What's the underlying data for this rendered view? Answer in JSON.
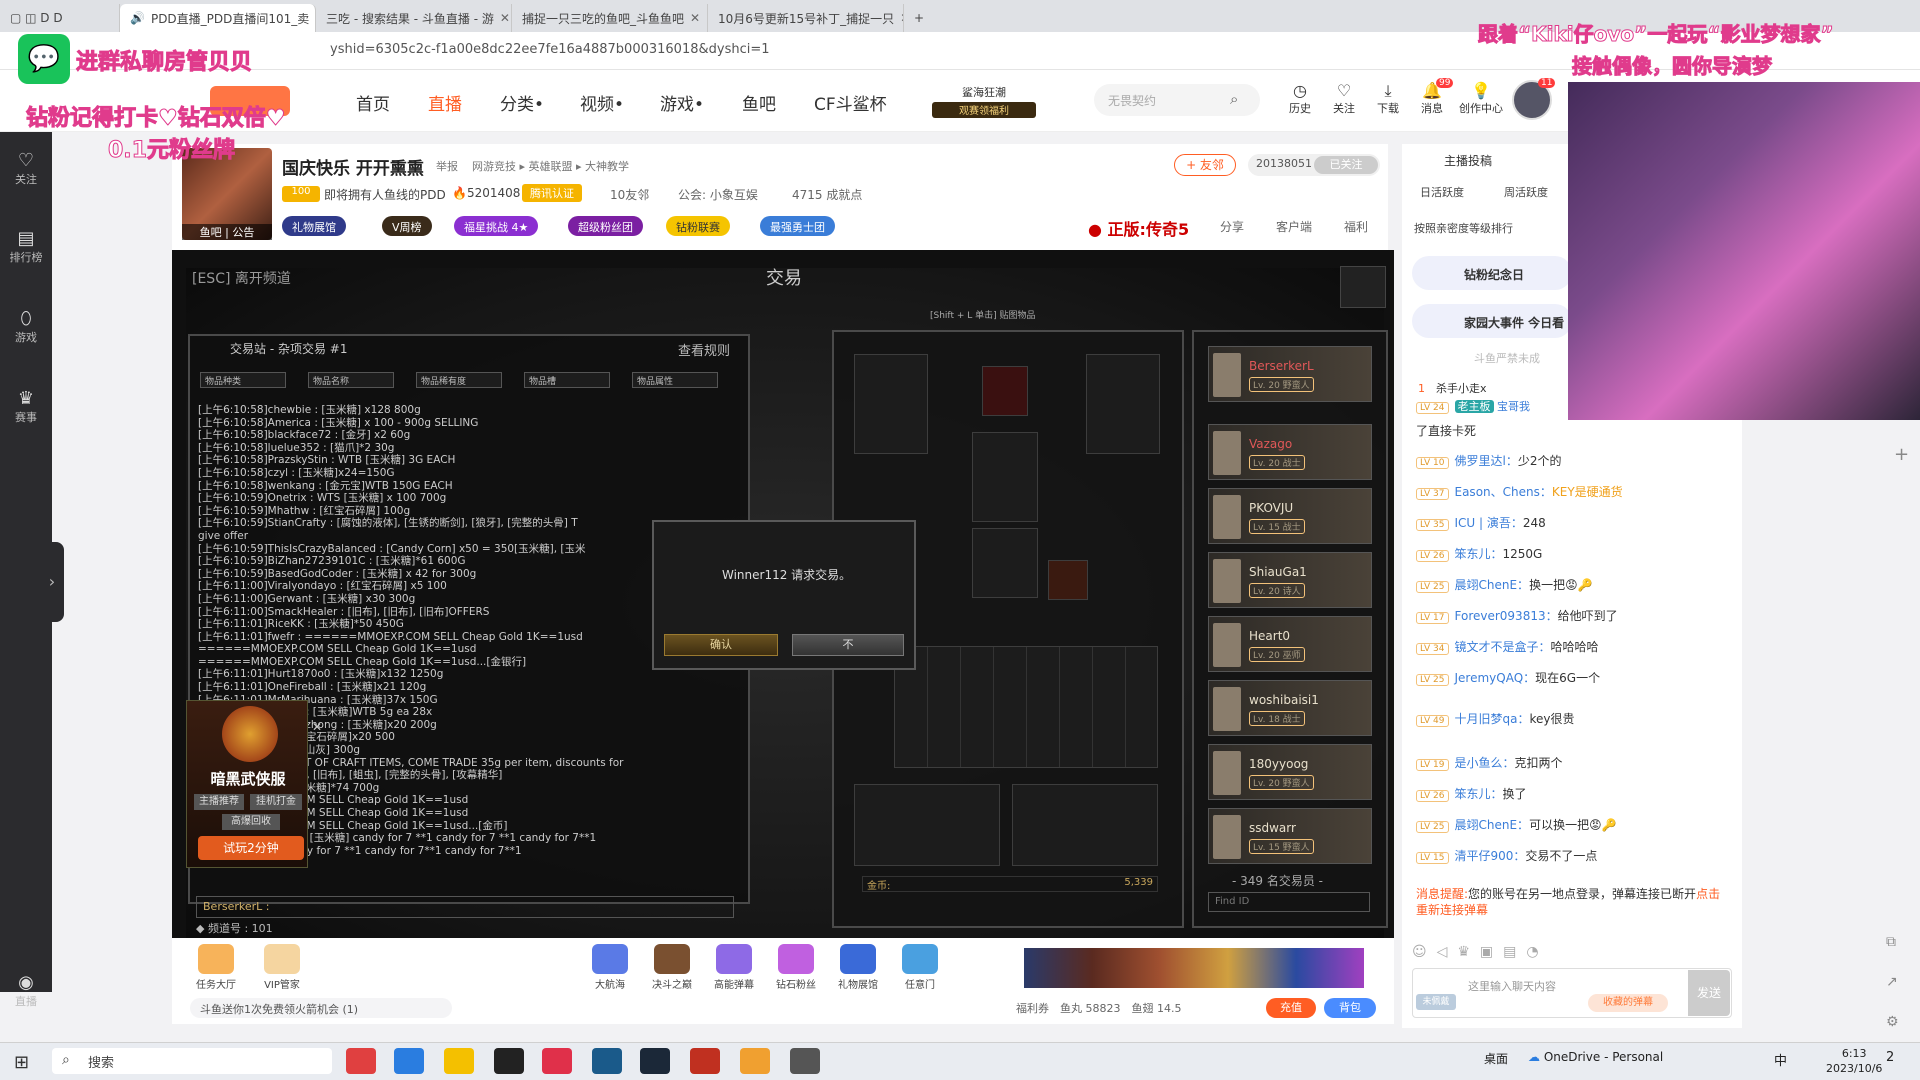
{
  "browser": {
    "tabs": [
      {
        "label": "PDD直播_PDD直播间101_卖"
      },
      {
        "label": "三吃 - 搜索结果 - 斗鱼直播 - 游"
      },
      {
        "label": "捕捉一只三吃的鱼吧_斗鱼鱼吧"
      },
      {
        "label": "10月6号更新15号补丁_捕捉一只"
      }
    ],
    "url": "yshid=6305c2c-f1a00e8dc22ee7fe16a4887b000316018&dyshci=1"
  },
  "overlay": {
    "wechat_text": "进群私聊房管贝贝",
    "promo_line1": "钻粉记得打卡♥钻石双倍♥",
    "promo_line2": "0.1元粉丝牌",
    "top_right_line1": "跟着“Kiki仔ovo”一起玩“影业梦想家”",
    "top_right_line2": "接触偶像，圆你导演梦"
  },
  "header": {
    "nav": [
      "首页",
      "直播",
      "分类•",
      "视频•",
      "游戏•",
      "鱼吧",
      "CF斗鲨杯"
    ],
    "promo": "鲨海狂潮",
    "promo_sub": "观赛领福利",
    "search_placeholder": "无畏契约",
    "icons": [
      {
        "label": "历史",
        "icon": "clock-icon"
      },
      {
        "label": "关注",
        "icon": "heart-icon"
      },
      {
        "label": "下载",
        "icon": "download-icon"
      },
      {
        "label": "消息",
        "icon": "bell-icon",
        "badge": "99"
      },
      {
        "label": "创作中心",
        "icon": "bulb-icon"
      }
    ],
    "avatar_badge": "11"
  },
  "sidebar": [
    {
      "label": "关注",
      "icon": "heart-icon"
    },
    {
      "label": "排行榜",
      "icon": "rank-icon"
    },
    {
      "label": "游戏",
      "icon": "gamepad-icon"
    },
    {
      "label": "赛事",
      "icon": "trophy-icon"
    },
    {
      "label": "直播",
      "icon": "camera-icon"
    }
  ],
  "room": {
    "avatar_tag": "鱼吧 | 公告",
    "title": "国庆快乐 开开熏熏",
    "report": "举报",
    "category": "网游竞技 ▸ 英雄联盟 ▸ 大神教学",
    "friend_btn": "+ 友邻",
    "room_id": "20138051",
    "follow_state": "已关注",
    "level": "100",
    "owner": "即将拥有人鱼线的PDD",
    "heat": "5201408",
    "verified": "腾讯认证",
    "neighbors": "10友邻",
    "guild": "公会: 小象互娱",
    "achievements": "4715 成就点",
    "ad_game": "正版:传奇5",
    "share": "分享",
    "client": "客户端",
    "welfare": "福利",
    "badges": [
      "礼物展馆",
      "V周榜",
      "福星挑战 4★",
      "超级粉丝团",
      "钻粉联赛",
      "最强勇士团"
    ]
  },
  "game": {
    "esc": "[ESC] 离开频道",
    "title": "交易",
    "panel_title": "交易站 - 杂项交易 #1",
    "rules": "查看规则",
    "filters": [
      "物品种类",
      "物品名称",
      "物品稀有度",
      "物品槽",
      "物品属性"
    ],
    "chat_lines": [
      "[上午6:10:58]chewbie : [玉米糖] x128 800g",
      "[上午6:10:58]America : [玉米糖] x 100 - 900g SELLING",
      "[上午6:10:58]blackface72 : [金牙] x2 60g",
      "[上午6:10:58]luelue352 : [猫爪]*2 30g",
      "[上午6:10:58]PrazskyStin : WTB [玉米糖] 3G EACH",
      "[上午6:10:58]czyl : [玉米糖]x24=150G",
      "[上午6:10:58]wenkang : [金元宝]WTB 150G EACH",
      "[上午6:10:59]Onetrix : WTS [玉米糖] x 100 700g",
      "[上午6:10:59]Mhathw : [红宝石碎屑] 100g",
      "[上午6:10:59]StianCrafty : [腐蚀的液体], [生锈的断剑], [狼牙], [完整的头骨] T",
      "      give offer",
      "[上午6:10:59]ThisIsCrazyBalanced : [Candy Corn] x50 = 350[玉米糖], [玉米",
      "[上午6:10:59]BiZhan27239101C : [玉米糖]*61 600G",
      "[上午6:10:59]BasedGodCoder : [玉米糖] x 42 for 300g",
      "[上午6:11:00]Viralyondayo : [红宝石碎屑] x5 100",
      "[上午6:11:00]Gerwant : [玉米糖] x30 300g",
      "[上午6:11:00]SmackHealer : [旧布], [旧布], [旧布]OFFERS",
      "[上午6:11:01]RiceKK : [玉米糖]*50 450G",
      "[上午6:11:01]fwefr : ======MMOEXP.COM SELL Cheap Gold 1K==1usd",
      "                ======MMOEXP.COM SELL Cheap Gold 1K==1usd",
      "                ======MMOEXP.COM SELL Cheap Gold 1K==1usd...[金银行]",
      "[上午6:11:01]Hurt1870o0 : [玉米糖]x132 1250g",
      "[上午6:11:01]OneFireball : [玉米糖]x21 120g",
      "[上午6:11:01]MrMarihuana : [玉米糖]37x 150G",
      "[上午6:11:01]ranger : [玉米糖]WTB 5g ea 28x",
      "[上午6:11:01]wuxingzhong : [玉米糖]x20 200g",
      "[上午6:11:01]Hz : [红宝石碎屑]x20 500",
      "[上午6:11:01]xx : [火山灰] 300g",
      "[上午6:11:01]nn : LOT OF CRAFT ITEMS, COME TRADE 35g per item, discounts for",
      "      package [骇骨的头骨], [旧布], [蛆虫], [完整的头骨], [攻幕精华]",
      "[上午6:11:01]ba : [玉米糖]*74 700g",
      "                ======EZG2G.COM SELL Cheap Gold 1K==1usd",
      "                ======EZG2G.COM SELL Cheap Gold 1K==1usd",
      "                ======EZG2G.COM SELL Cheap Gold 1K==1usd...[金币]",
      "[上午6:11:01]candy : [玉米糖] candy for 7 **1 candy for 7 **1 candy for 7**1",
      "      candy for 7 **1 candy for 7 **1 candy for 7**1 candy for 7**1"
    ],
    "chat_input": "BerserkerL :",
    "channel": "◆ 频道号 : 101",
    "equip_hint": "[Shift + L 单击] 贴图物品",
    "gold_label": "金币:",
    "gold_value": "5,339",
    "players": [
      {
        "name": "BerserkerL",
        "level": "Lv. 20 野蛮人",
        "color": "#e05858"
      },
      {
        "name": "Vazago",
        "level": "Lv. 20 战士",
        "color": "#e05858"
      },
      {
        "name": "PKOVJU",
        "level": "Lv. 15 战士",
        "color": "#e8e0cc"
      },
      {
        "name": "ShiauGa1",
        "level": "Lv. 20 诗人",
        "color": "#e8e0cc"
      },
      {
        "name": "Heart0",
        "level": "Lv. 20 巫师",
        "color": "#e8e0cc"
      },
      {
        "name": "woshibaisi1",
        "level": "Lv. 18 战士",
        "color": "#e8e0cc"
      },
      {
        "name": "180yyoog",
        "level": "Lv. 20 野蛮人",
        "color": "#e8e0cc"
      },
      {
        "name": "ssdwarr",
        "level": "Lv. 15 野蛮人",
        "color": "#e8e0cc"
      }
    ],
    "player_count": "- 349 名交易员 -",
    "find_placeholder": "Find ID",
    "dialog_text": "Winner112 请求交易。",
    "accept": "确认",
    "decline": "不"
  },
  "ad": {
    "title": "暗黑武侠服",
    "tags": [
      "主播推荐",
      "挂机打金",
      "高爆回收"
    ],
    "button": "试玩2分钟"
  },
  "giftbar": {
    "left": [
      "任务大厅",
      "VIP管家"
    ],
    "center": [
      "大航海",
      "决斗之巅",
      "高能弹幕",
      "钻石粉丝",
      "礼物展馆",
      "任意门"
    ],
    "free_gift": "斗鱼送你1次免费领火箭机会 (1)",
    "welfare": "福利券",
    "fish_balls": "鱼丸 58823",
    "fish_fins": "鱼翅 14.5",
    "recharge": "充值",
    "bag": "背包"
  },
  "right": {
    "host_posts": "主播投稿",
    "tabs": [
      "日活跃度",
      "周活跃度"
    ],
    "rank_title": "按照亲密度等级排行",
    "banners": [
      "钻粉纪念日",
      "家园大事件 今日看"
    ],
    "muted_note": "斗鱼严禁未成",
    "top_entries": [
      {
        "rank": "1",
        "name": "杀手小走x"
      },
      {
        "level": "LV 24",
        "tag": "老主板",
        "name": "宝哥我"
      }
    ],
    "danmu": [
      {
        "level": "",
        "user": "",
        "text": "了直接卡死"
      },
      {
        "level": "LV 10",
        "user": "佛罗里达l：",
        "text": "少2个的"
      },
      {
        "level": "LV 37",
        "user": "Eason、Chens：",
        "text": "KEY是硬通货",
        "textcolor": "#f0a11c"
      },
      {
        "level": "LV 35",
        "user": "ICU | 演吾：",
        "text": "248"
      },
      {
        "level": "LV 26",
        "user": "笨东儿：",
        "text": "1250G"
      },
      {
        "level": "LV 25",
        "user": "晨翊ChenE：",
        "text": "换一把😡🔑"
      },
      {
        "level": "LV 17",
        "user": "Forever093813：",
        "text": "给他吓到了"
      },
      {
        "level": "LV 34",
        "user": "镜文才不是盒子：",
        "text": "哈哈哈哈"
      },
      {
        "level": "LV 25",
        "user": "JeremyQAQ：",
        "text": "现在6G一个"
      },
      {
        "level": "LV 49",
        "user": "十月旧梦qa：",
        "text": "key很贵"
      },
      {
        "level": "LV 19",
        "user": "是小鱼么：",
        "text": "克扣两个"
      },
      {
        "level": "LV 26",
        "user": "笨东儿：",
        "text": "换了"
      },
      {
        "level": "LV 25",
        "user": "晨翊ChenE：",
        "text": "可以换一把😡🔑"
      },
      {
        "level": "LV 15",
        "user": "清平仔900：",
        "text": "交易不了一点"
      }
    ],
    "sys_label": "消息提醒:",
    "sys_text": "您的账号在另一地点登录，弹幕连接已断开",
    "sys_link": "点击重新连接弹幕",
    "chat_placeholder": "这里输入聊天内容",
    "danmu_tag": "收藏的弹幕",
    "send": "发送",
    "fans_tag": "未佩戴"
  },
  "taskbar": {
    "search": "搜索",
    "desktop": "桌面",
    "onedrive": "OneDrive - Personal",
    "ime": "中",
    "time": "6:13",
    "date": "2023/10/6",
    "notif": "2"
  },
  "colors": {
    "accent": "#ff5d23",
    "link": "#3a7dd8",
    "game_gold": "#c9a75c"
  }
}
